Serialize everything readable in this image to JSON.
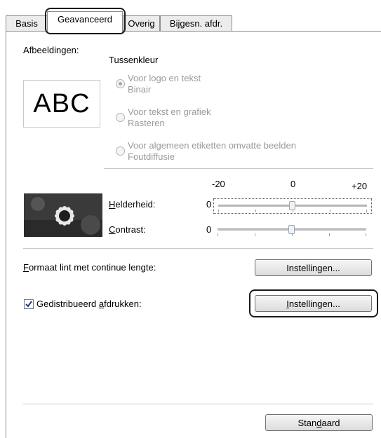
{
  "tabs": {
    "basic": "Basis",
    "advanced": "Geavanceerd",
    "other": "Overig",
    "trim": "Bijgesn. afdr."
  },
  "images_section": {
    "label": "Afbeeldingen:",
    "preview_text": "ABC",
    "halftone_label": "Tussenkleur",
    "options": [
      {
        "title": "Voor logo en tekst",
        "sub": "Binair",
        "selected": true
      },
      {
        "title": "Voor tekst en grafiek",
        "sub": "Rasteren",
        "selected": false
      },
      {
        "title": "Voor algemeen etiketten omvatte beelden",
        "sub": "Foutdiffusie",
        "selected": false
      }
    ]
  },
  "adjust": {
    "scale_min": "-20",
    "scale_mid": "0",
    "scale_max": "+20",
    "brightness_label": "Helderheid:",
    "brightness_value": "0",
    "contrast_label": "Contrast:",
    "contrast_value": "0"
  },
  "continuous": {
    "label": "Formaat lint met continue lengte:",
    "button": "Instellingen..."
  },
  "distributed": {
    "label": "Gedistribueerd afdrukken:",
    "checked": true,
    "button": "Instellingen..."
  },
  "footer": {
    "default_button": "Standaard"
  }
}
